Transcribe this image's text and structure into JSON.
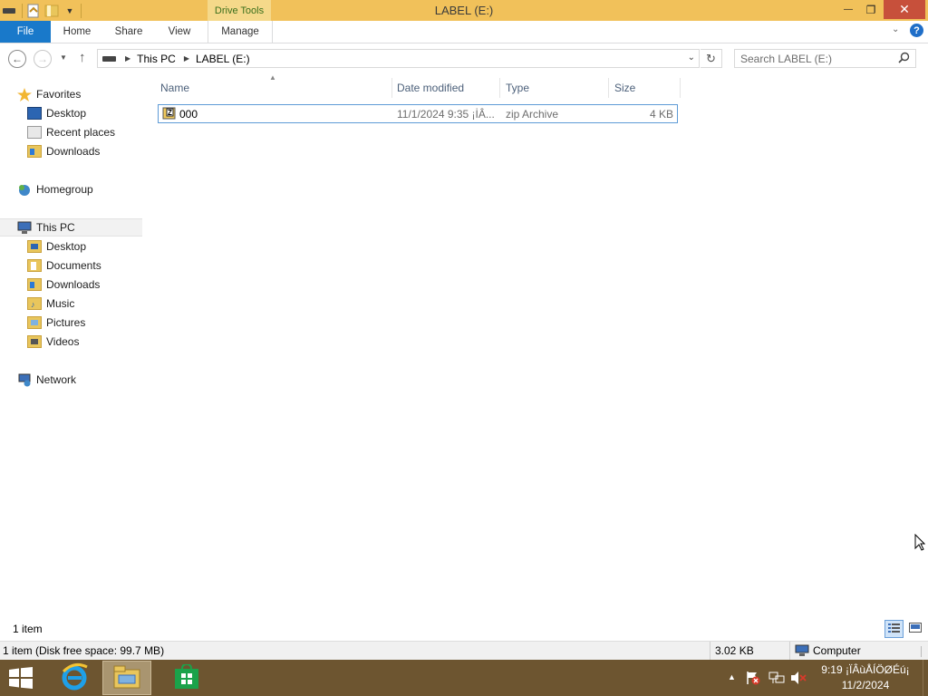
{
  "window": {
    "title": "LABEL (E:)",
    "contextual_tab_group": "Drive Tools",
    "minimize_glyph": "—",
    "restore_glyph": "❐",
    "close_glyph": "✕"
  },
  "ribbon": {
    "tabs": [
      {
        "label": "File"
      },
      {
        "label": "Home"
      },
      {
        "label": "Share"
      },
      {
        "label": "View"
      },
      {
        "label": "Manage"
      }
    ],
    "help_glyph": "?"
  },
  "address": {
    "crumbs": [
      "This PC",
      "LABEL (E:)"
    ],
    "search_placeholder": "Search LABEL (E:)"
  },
  "nav": {
    "favorites": {
      "label": "Favorites",
      "items": [
        "Desktop",
        "Recent places",
        "Downloads"
      ]
    },
    "homegroup": "Homegroup",
    "this_pc": {
      "label": "This PC",
      "items": [
        "Desktop",
        "Documents",
        "Downloads",
        "Music",
        "Pictures",
        "Videos"
      ]
    },
    "network": "Network"
  },
  "list": {
    "columns": [
      "Name",
      "Date modified",
      "Type",
      "Size"
    ],
    "rows": [
      {
        "name": "000",
        "date": "11/1/2024 9:35 ¡İÂ...",
        "type": "zip Archive",
        "size": "4 KB"
      }
    ]
  },
  "status": {
    "item_count": "1 item",
    "bar_left": "1 item (Disk free space: 99.7 MB)",
    "bar_size": "3.02 KB",
    "bar_location": "Computer"
  },
  "taskbar": {
    "clock_time": "9:19 ¡ÏÂùÅÍÖØÉú¡",
    "clock_date": "11/2/2024"
  },
  "colors": {
    "title_bar": "#f1c15a",
    "file_tab": "#1979ca",
    "close_button": "#c7503b",
    "taskbar": "#6d5530"
  }
}
